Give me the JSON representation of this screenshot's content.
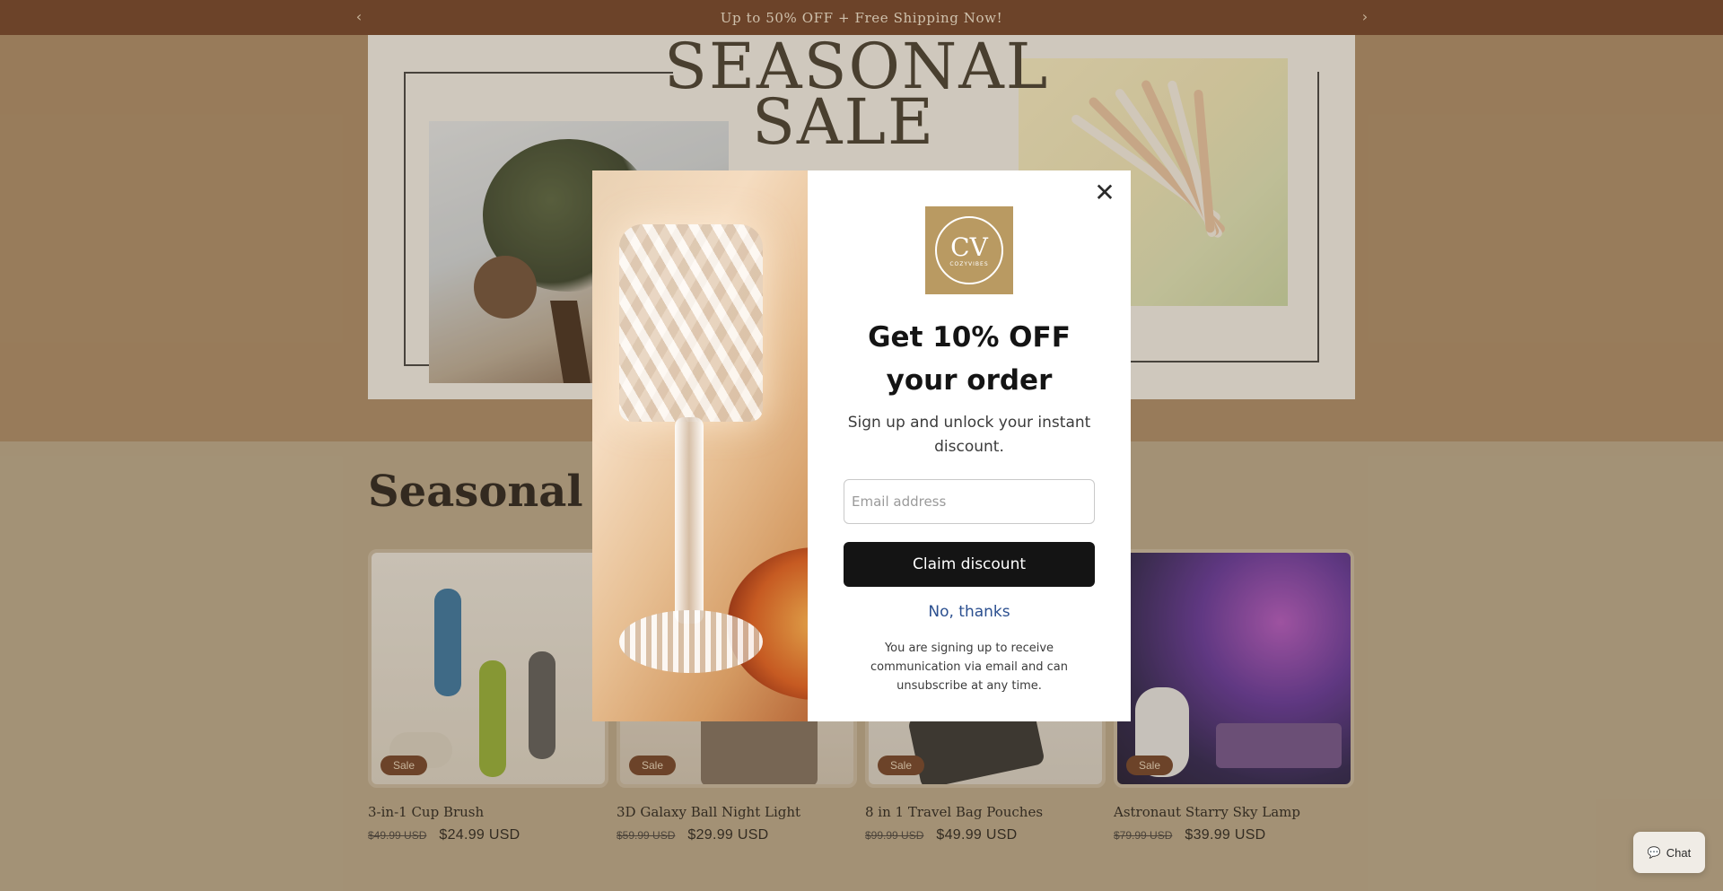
{
  "announcement": {
    "text": "Up to 50% OFF + Free Shipping Now!",
    "prev_icon": "chevron-left-icon",
    "next_icon": "chevron-right-icon",
    "prev_glyph": "‹",
    "next_glyph": "›"
  },
  "hero": {
    "title_line1": "SEASONAL",
    "title_line2": "SALE"
  },
  "section": {
    "title": "Seasonal Specials"
  },
  "products": [
    {
      "title": "3-in-1 Cup Brush",
      "price_old": "$49.99 USD",
      "price_new": "$24.99 USD",
      "badge": "Sale"
    },
    {
      "title": "3D Galaxy Ball Night Light",
      "price_old": "$59.99 USD",
      "price_new": "$29.99 USD",
      "badge": "Sale"
    },
    {
      "title": "8 in 1 Travel Bag Pouches",
      "price_old": "$99.99 USD",
      "price_new": "$49.99 USD",
      "badge": "Sale"
    },
    {
      "title": "Astronaut Starry Sky Lamp",
      "price_old": "$79.99 USD",
      "price_new": "$39.99 USD",
      "badge": "Sale"
    }
  ],
  "modal": {
    "close_glyph": "✕",
    "logo_text": "COZYVIBES",
    "logo_mark": "CV",
    "heading": "Get 10% OFF your order",
    "subheading": "Sign up and unlock your instant discount.",
    "email_placeholder": "Email address",
    "claim_label": "Claim discount",
    "decline_label": "No, thanks",
    "legal": "You are signing up to receive communication via email and can unsubscribe at any time."
  },
  "chat": {
    "label": "Chat",
    "icon": "chat-bubble-icon",
    "glyph": "💬"
  },
  "colors": {
    "announcement_bg": "#6b3a1f",
    "sale_badge": "#6b3a1f",
    "link_blue": "#2b4f8f",
    "button_black": "#141414"
  }
}
